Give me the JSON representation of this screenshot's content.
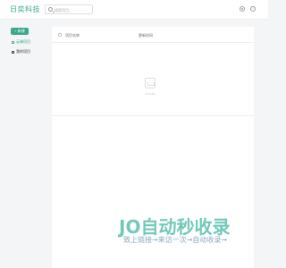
{
  "header": {
    "logo": "日奕科技",
    "search": {
      "placeholder": "搜索项目...",
      "value": ""
    },
    "icons": [
      "gear-icon",
      "info-icon"
    ],
    "info_glyph": "!"
  },
  "sidebar": {
    "new_button_label": "+ 新建",
    "items": [
      {
        "label": "云端项目",
        "active": true,
        "icon": "cloud-icon"
      },
      {
        "label": "我的项目",
        "active": false,
        "icon": "folder-icon"
      }
    ]
  },
  "table": {
    "columns": [
      "项目名称",
      "更新时间"
    ],
    "rows": [],
    "empty_text": "No Data"
  },
  "watermark": {
    "logo_text": "JO自动秒收录",
    "subtitle": "致上链接→来访一次→自动收录→"
  },
  "colors": {
    "accent": "#3aa88f",
    "background": "#f4f5f7"
  }
}
